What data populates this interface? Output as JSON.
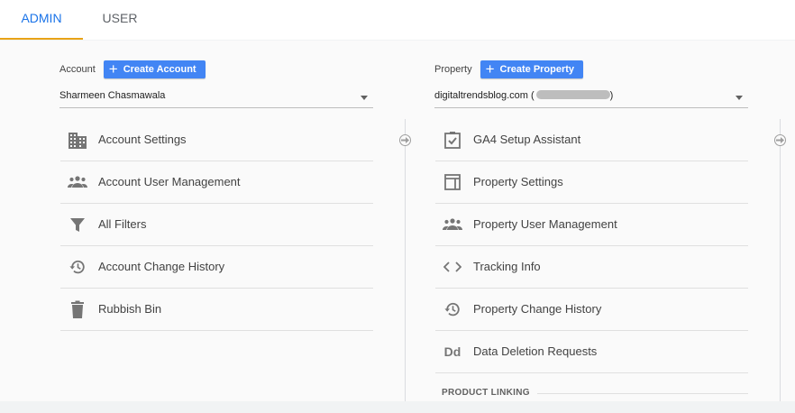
{
  "tabs": [
    {
      "label": "ADMIN",
      "active": true
    },
    {
      "label": "USER",
      "active": false
    }
  ],
  "account": {
    "label": "Account",
    "create_label": "Create Account",
    "selected": "Sharmeen Chasmawala",
    "menu": [
      {
        "label": "Account Settings",
        "icon": "building-icon"
      },
      {
        "label": "Account User Management",
        "icon": "people-icon"
      },
      {
        "label": "All Filters",
        "icon": "filter-icon"
      },
      {
        "label": "Account Change History",
        "icon": "history-icon"
      },
      {
        "label": "Rubbish Bin",
        "icon": "trash-icon"
      }
    ]
  },
  "property": {
    "label": "Property",
    "create_label": "Create Property",
    "selected": "digitaltrendsblog.com (",
    "selected_suffix": ")",
    "menu": [
      {
        "label": "GA4 Setup Assistant",
        "icon": "checklist-icon"
      },
      {
        "label": "Property Settings",
        "icon": "layout-icon"
      },
      {
        "label": "Property User Management",
        "icon": "people-icon"
      },
      {
        "label": "Tracking Info",
        "icon": "code-icon"
      },
      {
        "label": "Property Change History",
        "icon": "history-icon"
      },
      {
        "label": "Data Deletion Requests",
        "icon": "dd-icon",
        "icon_text": "Dd"
      }
    ],
    "section_title": "PRODUCT LINKING"
  },
  "colors": {
    "accent": "#1a73e8",
    "button": "#4285f4",
    "tab_indicator": "#e8a317",
    "icon": "#757575"
  }
}
